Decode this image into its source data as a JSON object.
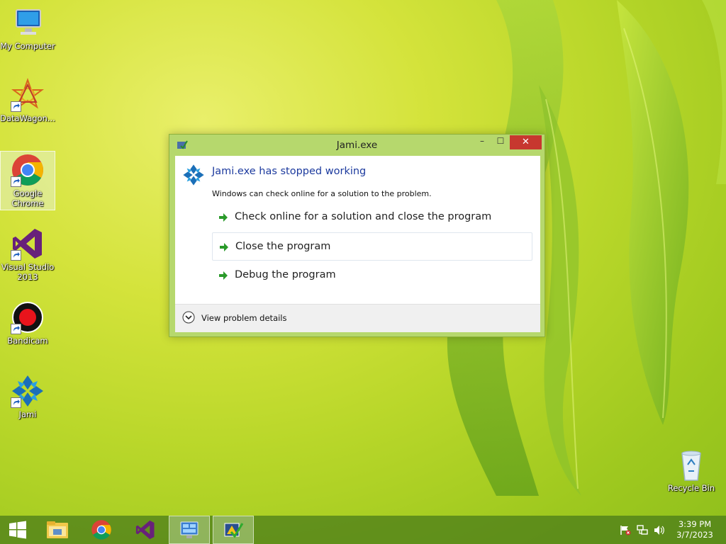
{
  "desktop": {
    "icons": [
      {
        "label": "My Computer"
      },
      {
        "label": "DataWagon..."
      },
      {
        "label": "Google Chrome"
      },
      {
        "label": "Visual Studio 2013"
      },
      {
        "label": "Bandicam"
      },
      {
        "label": "Jami"
      },
      {
        "label": "Recycle Bin"
      }
    ]
  },
  "dialog": {
    "title": "Jami.exe",
    "main_instruction": "Jami.exe has stopped working",
    "content": "Windows can check online for a solution to the problem.",
    "commands": [
      {
        "label": "Check online for a solution and close the program"
      },
      {
        "label": "Close the program"
      },
      {
        "label": "Debug the program"
      }
    ],
    "details_label": "View problem details",
    "close_glyph": "✕",
    "minimize_glyph": "–",
    "maximize_glyph": "☐"
  },
  "taskbar": {
    "clock_time": "3:39 PM",
    "clock_date": "3/7/2023"
  },
  "colors": {
    "accent_link": "#1c3a9e",
    "close_button": "#c7372f",
    "dialog_frame": "#b6d86d",
    "arrow_green": "#2a9a2a"
  }
}
